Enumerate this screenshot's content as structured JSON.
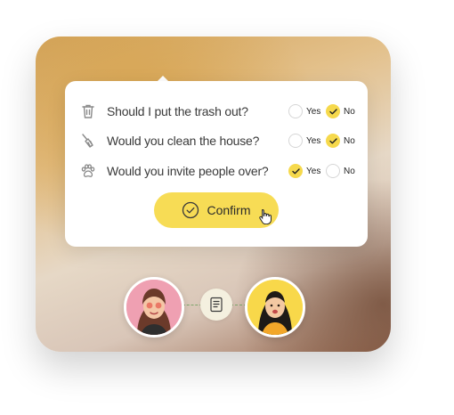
{
  "questions": [
    {
      "text": "Should I put the trash out?",
      "icon": "trash-icon",
      "yes_label": "Yes",
      "no_label": "No",
      "answer": "no"
    },
    {
      "text": "Would you clean the house?",
      "icon": "broom-icon",
      "yes_label": "Yes",
      "no_label": "No",
      "answer": "no"
    },
    {
      "text": "Would you invite people over?",
      "icon": "paw-icon",
      "yes_label": "Yes",
      "no_label": "No",
      "answer": "yes"
    }
  ],
  "confirm": {
    "label": "Confirm",
    "icon": "check-circle-icon"
  },
  "participants": [
    {
      "name_icon": "avatar-woman-pink"
    },
    {
      "name_icon": "avatar-woman-yellow"
    }
  ],
  "document_icon": "document-icon",
  "colors": {
    "accent": "#f7dc55",
    "connector": "#7da56a"
  }
}
